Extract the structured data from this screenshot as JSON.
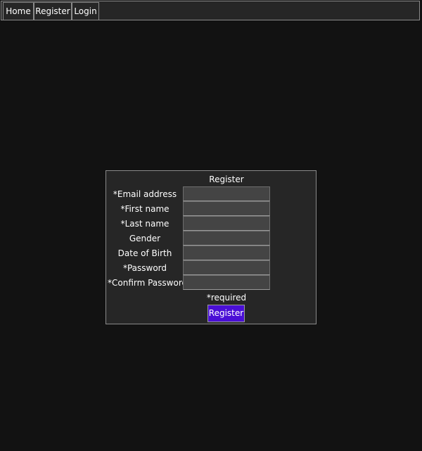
{
  "nav": {
    "home": "Home",
    "register": "Register",
    "login": "Login"
  },
  "form": {
    "title": "Register",
    "fields": [
      {
        "label": "*Email address",
        "value": ""
      },
      {
        "label": "*First name",
        "value": ""
      },
      {
        "label": "*Last name",
        "value": ""
      },
      {
        "label": "Gender",
        "value": ""
      },
      {
        "label": "Date of Birth",
        "value": ""
      },
      {
        "label": "*Password",
        "value": ""
      },
      {
        "label": "*Confirm Password",
        "value": ""
      }
    ],
    "required_note": "*required",
    "submit_label": "Register",
    "submit_color": "#4a0fd6"
  }
}
